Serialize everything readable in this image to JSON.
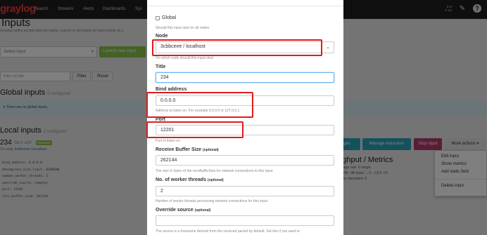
{
  "navbar": {
    "logo": "graylog",
    "items": [
      "Search",
      "Streams",
      "Alerts",
      "Dashboards",
      "Sys"
    ],
    "throughput_in": "0 in",
    "throughput_out": "0 out"
  },
  "page": {
    "title": "Inputs",
    "description": "Graylog nodes accept data via inputs. Launch or terminate as many inputs as y"
  },
  "launch": {
    "select_placeholder": "Select input",
    "button_label": "Launch new input"
  },
  "filter": {
    "placeholder": "Filter by title",
    "filter_label": "Filter",
    "reset_label": "Reset"
  },
  "global_inputs": {
    "heading": "Global inputs",
    "count": "0 configured",
    "empty_message": "There are no global inputs."
  },
  "local_inputs": {
    "heading": "Local inputs",
    "count": "1 configured",
    "input_name": "234",
    "input_type": "GELF UDP",
    "status_badge": "RUNNING",
    "on_node_prefix": "On node",
    "node_link": "3cbbceee / localhost",
    "config_lines": [
      "bind_address: 0.0.0.0",
      "decompress_size_limit: 8388608",
      "number_worker_threads: 2",
      "override_source: <empty>",
      "port: 12201",
      "recv_buffer_size: 262144"
    ],
    "buttons": {
      "messages": "Show received messages",
      "messages_visible": "ges",
      "extractors": "Manage extractors",
      "stop": "Stop input",
      "more": "More actions"
    },
    "throughput": {
      "heading": "oughput / Metrics",
      "line1": "e average rate: 0 msg/s",
      "line2": "ffic: ↔0B ↑0B (total: ↔0, ↓12.5 ↑0)",
      "line3": "essages discarded: 0"
    },
    "menu": [
      "Edit input",
      "Show metrics",
      "Add static field",
      "Delete input"
    ]
  },
  "modal": {
    "global_label": "Global",
    "global_help": "Should this input start on all nodes",
    "node_label": "Node",
    "node_value": "3cbbceee / localhost",
    "node_help": "On which node should this input start",
    "title_label": "Title",
    "title_value": "234",
    "bind_label": "Bind address",
    "bind_value": "0.0.0.0",
    "bind_help": "Address to listen on. For example 0.0.0.0 or 127.0.0.1.",
    "port_label": "Port",
    "port_value": "12201",
    "port_help": "Port to listen on.",
    "recv_label": "Receive Buffer Size",
    "optional": "(optional)",
    "recv_value": "262144",
    "recv_help": "The size in bytes of the recvBufferSize for network connections to this input.",
    "workers_label": "No. of worker threads",
    "workers_value": "2",
    "workers_help": "Number of worker threads processing network connections for this input.",
    "override_label": "Override source",
    "override_value": "",
    "override_help": "The source is a hostname derived from the received packet by default. Set this if you want to"
  },
  "colors": {
    "highlight": "#e01b1b",
    "logo": "#ff3633",
    "launch_button": "#8ac34c",
    "info_button": "#2aa2b8",
    "stop_button": "#b33c6d"
  }
}
